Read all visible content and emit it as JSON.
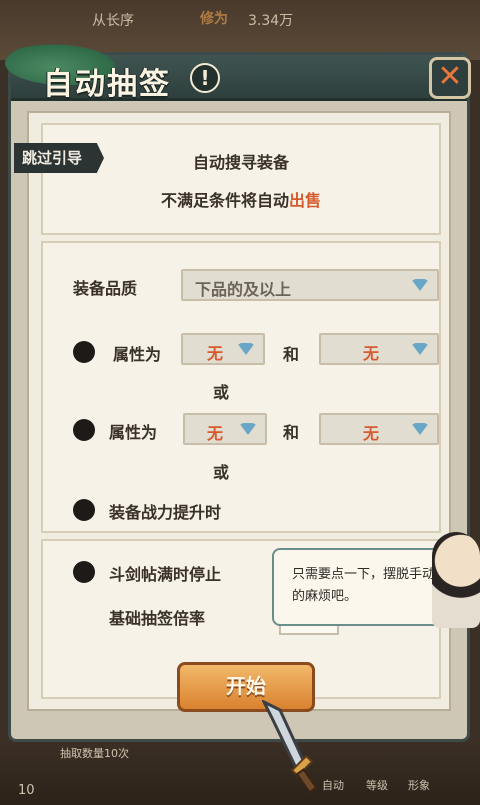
{
  "background": {
    "top_name": "从长序",
    "top_stat_label": "修为",
    "top_stat_value": "3.34万",
    "bottom_text": "抽取数量10次",
    "bottom_auto": "自动",
    "bottom_level": "等级",
    "bottom_shape": "形象",
    "bottom_number": "10"
  },
  "dialog": {
    "title": "自动抽签",
    "info_icon": "exclamation-circle-icon",
    "close_icon": "close-x-icon"
  },
  "skip_tag": "跳过引导",
  "intro": {
    "line1": "自动搜寻装备",
    "line2_prefix": "不满足条件将自动",
    "line2_highlight": "出售"
  },
  "filters": {
    "quality_label": "装备品质",
    "quality_value": "下品的及以上",
    "attr_label": "属性为",
    "and_label": "和",
    "or_label": "或",
    "attr1_a": "无",
    "attr1_b": "无",
    "attr2_a": "无",
    "attr2_b": "无",
    "power_label": "装备战力提升时"
  },
  "options": {
    "stop_label": "斗剑帖满时停止",
    "rate_label": "基础抽签倍率"
  },
  "bubble_text": "只需要点一下，摆脱手动的麻烦吧。",
  "start_label": "开始",
  "colors": {
    "accent": "#d75b2e",
    "header": "#2e3f3d",
    "button": "#e39a45"
  }
}
